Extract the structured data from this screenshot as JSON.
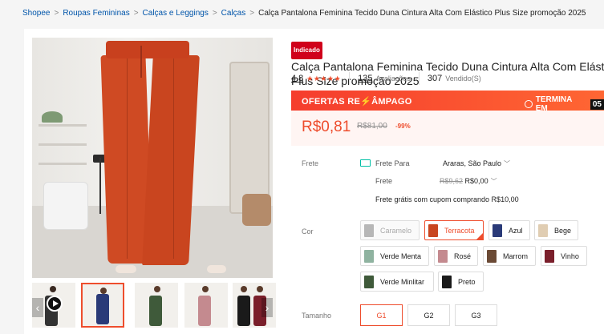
{
  "breadcrumb": {
    "items": [
      "Shopee",
      "Roupas Femininas",
      "Calças e Leggings",
      "Calças"
    ],
    "current": "Calça Pantalona Feminina Tecido Duna Cintura Alta Com Elástico Plus Size promoção 2025"
  },
  "product": {
    "badge": "Indicado",
    "title_line1": "Calça Pantalona Feminina Tecido Duna Cintura Alta Com Elástico",
    "title_line2": "Plus Size promoção 2025"
  },
  "stats": {
    "rating": "4.8",
    "stars": "★★★★★",
    "reviews_count": "135",
    "reviews_label": "Avaliações",
    "sold_count": "307",
    "sold_label": "Vendido(S)"
  },
  "flash_sale": {
    "title_part1": "OFERTAS RE",
    "bolt": "⚡",
    "title_part2": "ÂMPAGO",
    "ends_label": "TERMINA EM",
    "time": "05"
  },
  "price": {
    "current": "R$0,81",
    "original": "R$81,00",
    "discount": "-99%"
  },
  "shipping": {
    "label": "Frete",
    "to_label": "Frete Para",
    "destination": "Araras, São Paulo",
    "cost_label": "Frete",
    "cost_original": "R$9,62",
    "cost_now": "R$0,00",
    "free_note": "Frete grátis com cupom comprando R$10,00"
  },
  "colors": {
    "label": "Cor",
    "options": [
      {
        "name": "Caramelo",
        "swatch": "#b7b7b7",
        "state": "disabled"
      },
      {
        "name": "Terracota",
        "swatch": "#c9451f",
        "state": "selected"
      },
      {
        "name": "Azul",
        "swatch": "#2a3a78",
        "state": "normal"
      },
      {
        "name": "Bege",
        "swatch": "#e0cdb2",
        "state": "normal"
      },
      {
        "name": "Verde Menta",
        "swatch": "#8fb3a0",
        "state": "normal"
      },
      {
        "name": "Rosé",
        "swatch": "#c48a8f",
        "state": "normal"
      },
      {
        "name": "Marrom",
        "swatch": "#6b4a35",
        "state": "normal"
      },
      {
        "name": "Vinho",
        "swatch": "#7a1f2b",
        "state": "normal"
      },
      {
        "name": "Verde Minlitar",
        "swatch": "#3f5a3a",
        "state": "normal"
      },
      {
        "name": "Preto",
        "swatch": "#1a1a1a",
        "state": "normal"
      }
    ]
  },
  "sizes": {
    "label": "Tamanho",
    "options": [
      "G1",
      "G2",
      "G3"
    ],
    "selected": "G1"
  },
  "thumbnail_arrows": {
    "prev": "‹",
    "next": "›"
  }
}
